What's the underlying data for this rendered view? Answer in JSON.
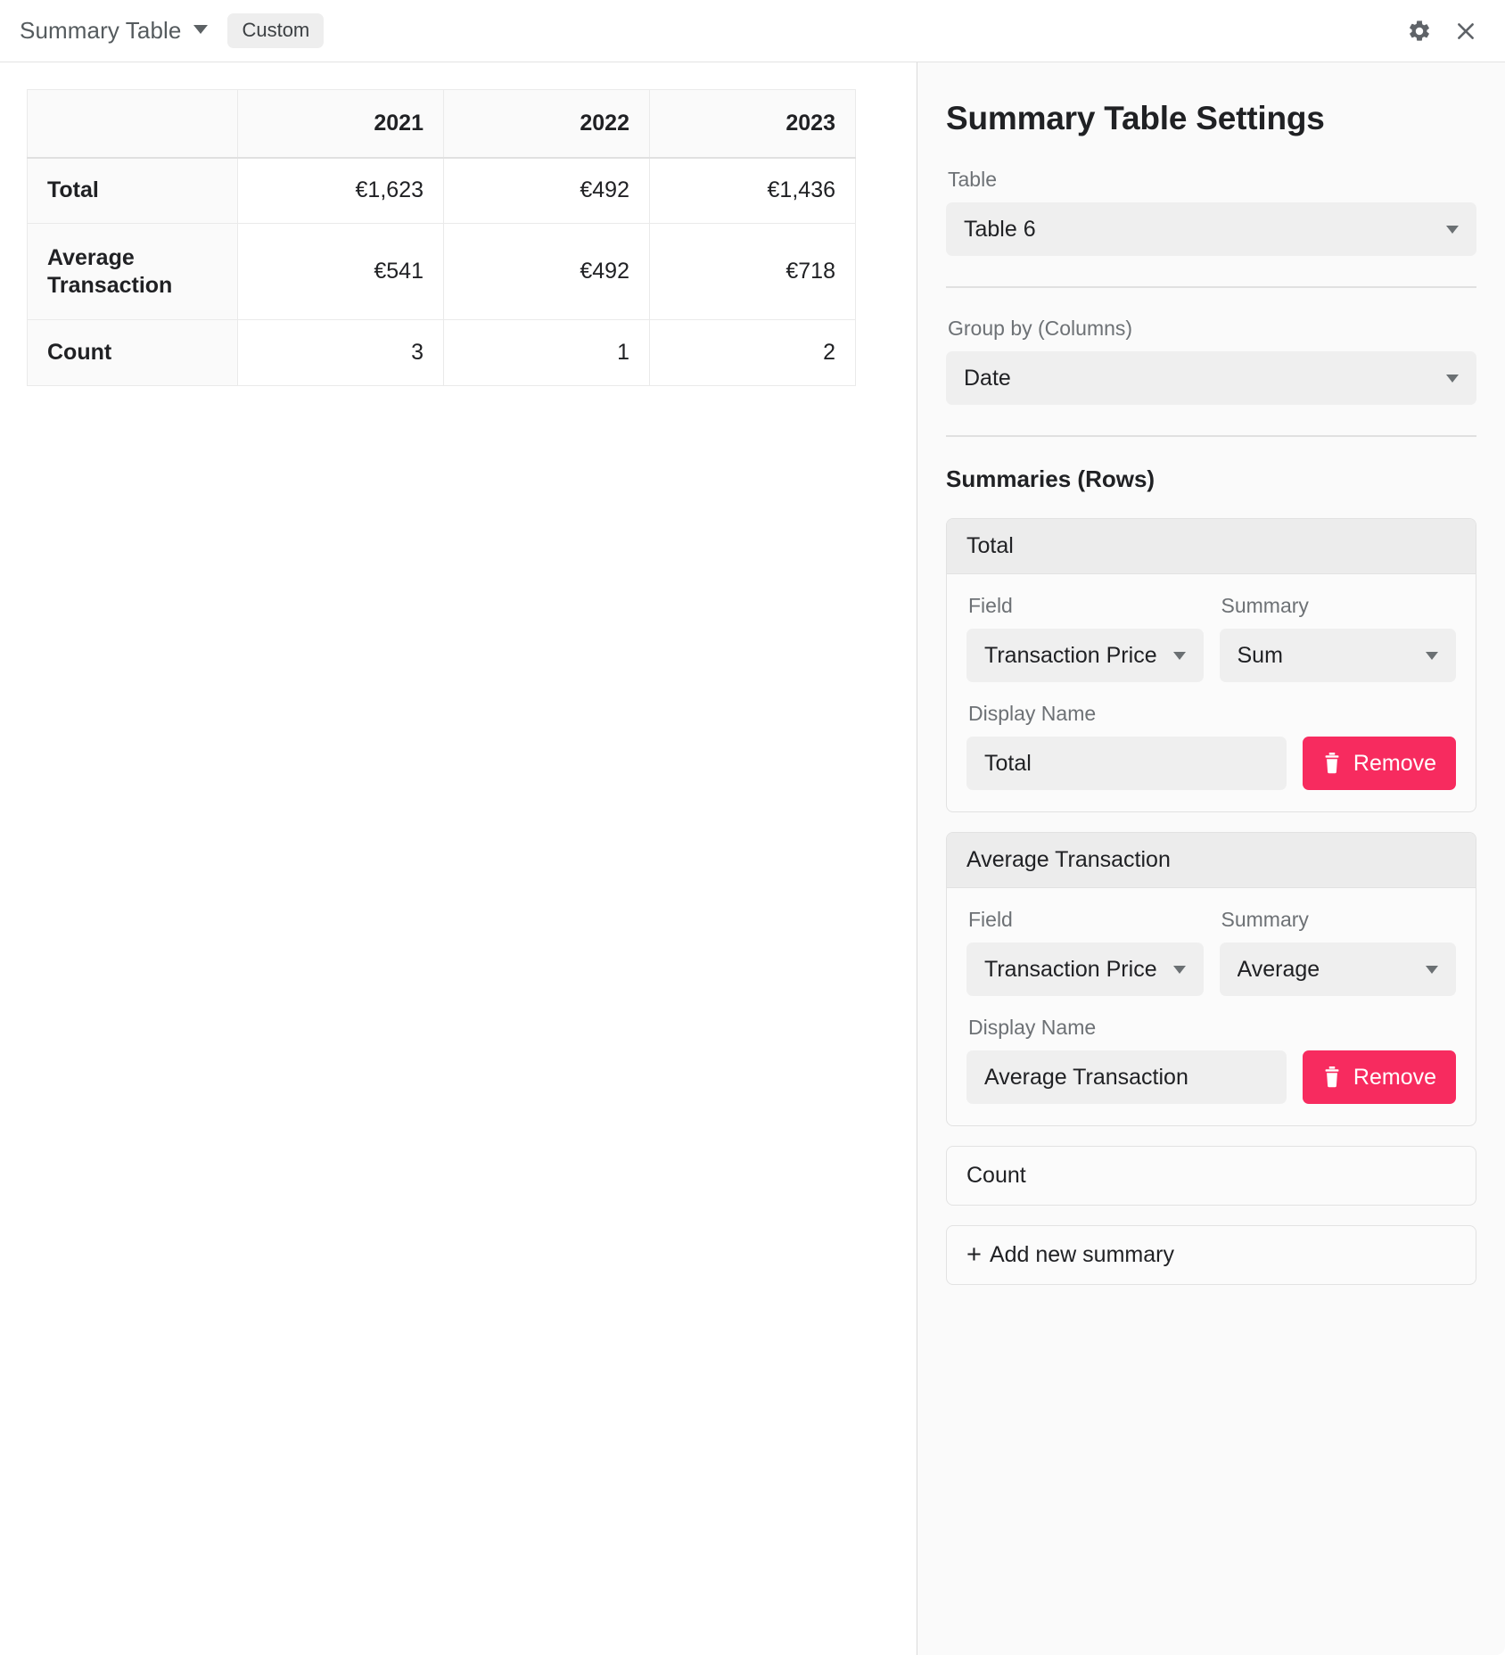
{
  "topbar": {
    "widget_name": "Summary Table",
    "mode_chip": "Custom",
    "settings_icon": "gear-icon",
    "close_icon": "close-icon"
  },
  "table": {
    "corner_header": "",
    "column_headers": [
      "2021",
      "2022",
      "2023"
    ],
    "rows": [
      {
        "label": "Total",
        "values": [
          "€1,623",
          "€492",
          "€1,436"
        ]
      },
      {
        "label": "Average Transaction",
        "values": [
          "€541",
          "€492",
          "€718"
        ]
      },
      {
        "label": "Count",
        "values": [
          "3",
          "1",
          "2"
        ]
      }
    ]
  },
  "settings": {
    "title": "Summary Table Settings",
    "table_label": "Table",
    "table_value": "Table 6",
    "group_by_label": "Group by (Columns)",
    "group_by_value": "Date",
    "summaries_label": "Summaries (Rows)",
    "field_label": "Field",
    "summary_label": "Summary",
    "display_name_label": "Display Name",
    "remove_label": "Remove",
    "add_new_label": "Add new summary",
    "add_new_plus": "+",
    "summaries": [
      {
        "header": "Total",
        "field": "Transaction Price",
        "summary": "Sum",
        "display_name": "Total",
        "expanded": true
      },
      {
        "header": "Average Transaction",
        "field": "Transaction Price",
        "summary": "Average",
        "display_name": "Average Transaction",
        "expanded": true
      },
      {
        "header": "Count",
        "expanded": false
      }
    ]
  },
  "colors": {
    "accent_remove": "#F72B5F",
    "panel_bg": "#FAFAFA",
    "input_bg": "#EFEFEF",
    "card_header_bg": "#ECECEC",
    "border": "#E2E2E2",
    "text": "#202124",
    "muted_text": "#6D7175"
  }
}
